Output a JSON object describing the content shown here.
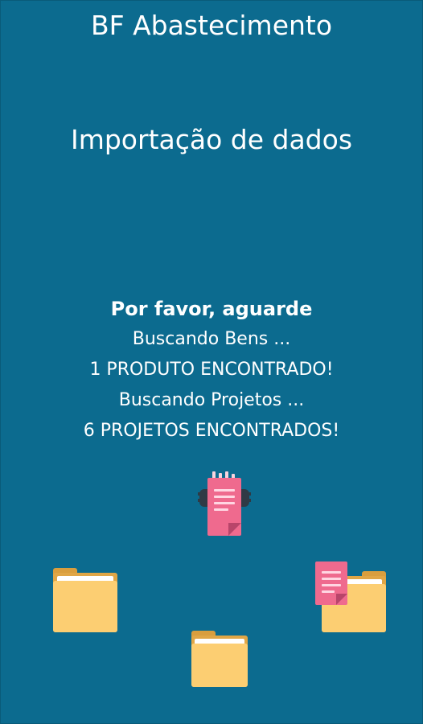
{
  "header": {
    "app_title": "BF Abastecimento"
  },
  "main": {
    "page_title": "Importação de dados",
    "wait_text": "Por favor, aguarde",
    "status_lines": [
      "Buscando Bens ...",
      "1 PRODUTO ENCONTRADO!",
      "Buscando Projetos ...",
      "6 PROJETOS ENCONTRADOS!"
    ]
  },
  "colors": {
    "background": "#0c6b8f",
    "folder": "#fcce72",
    "document": "#ef6a8e"
  },
  "icons": [
    "document-processing-icon",
    "folder-icon",
    "folder-icon",
    "folder-icon",
    "document-icon"
  ]
}
